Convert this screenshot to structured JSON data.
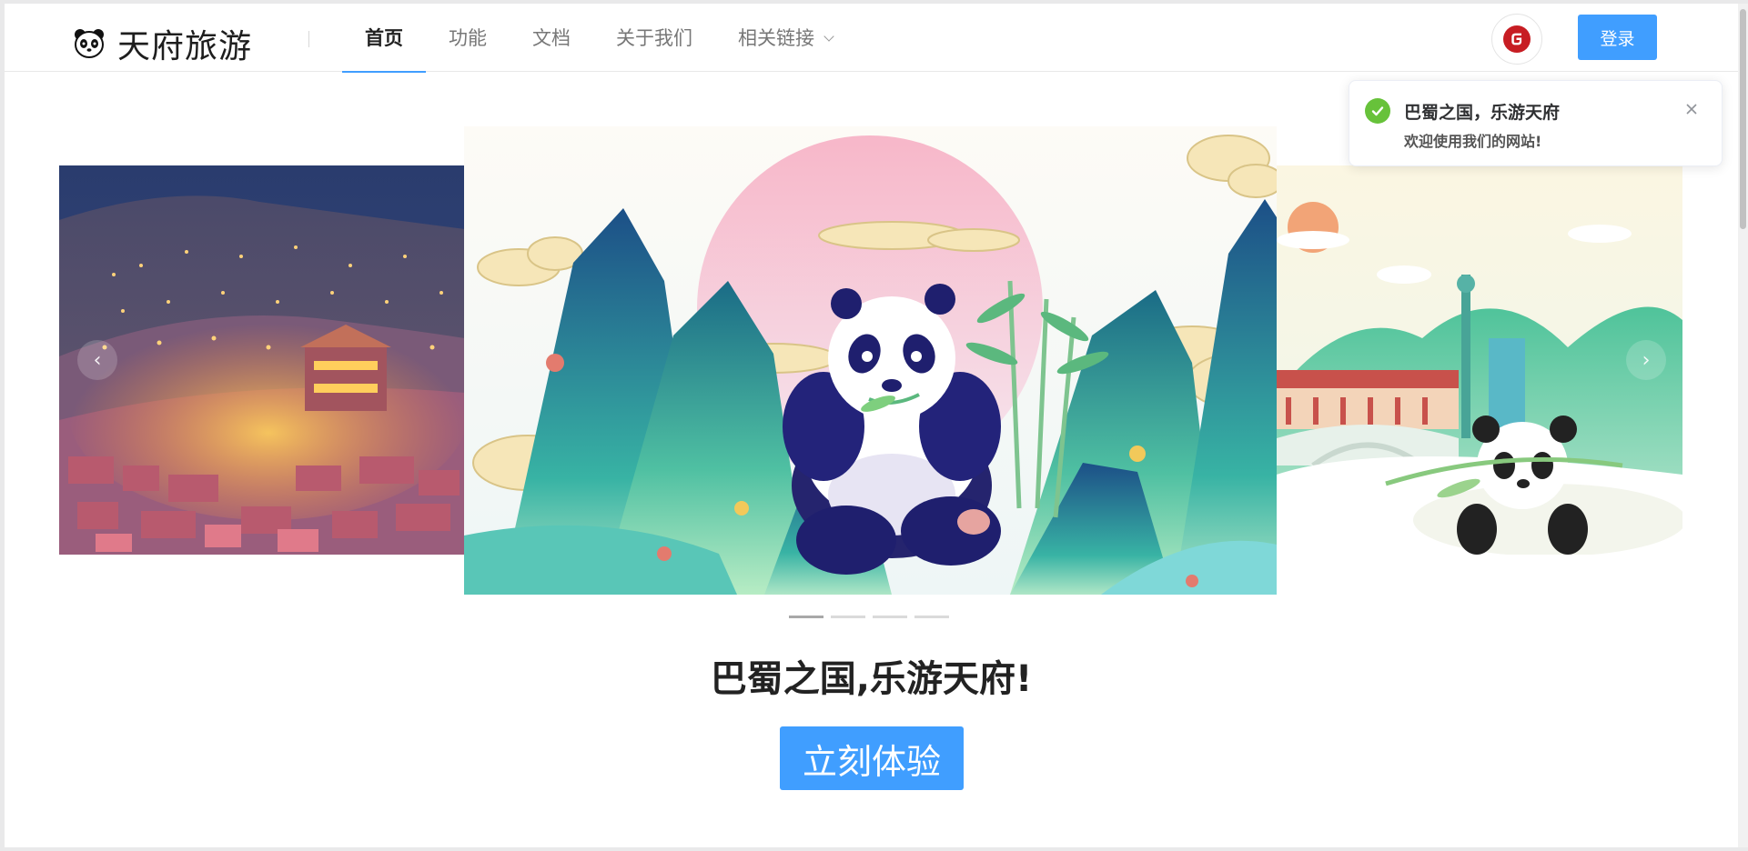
{
  "header": {
    "brand": "天府旅游",
    "nav": [
      {
        "label": "首页",
        "active": true
      },
      {
        "label": "功能",
        "active": false
      },
      {
        "label": "文档",
        "active": false
      },
      {
        "label": "关于我们",
        "active": false
      },
      {
        "label": "相关链接",
        "active": false,
        "dropdown": true
      }
    ],
    "gitee_icon": "gitee-icon",
    "login_label": "登录"
  },
  "carousel": {
    "slides": [
      "night-town-slide",
      "panda-mountains-slide",
      "panda-city-slide"
    ],
    "active_index": 1,
    "indicator_count": 4,
    "prev_icon": "‹",
    "next_icon": "›"
  },
  "main": {
    "slogan": "巴蜀之国,乐游天府!",
    "cta_label": "立刻体验"
  },
  "notification": {
    "type": "success",
    "title": "巴蜀之国，乐游天府",
    "message": "欢迎使用我们的网站!"
  },
  "colors": {
    "primary": "#409eff",
    "success": "#67c23a",
    "gitee": "#c71d23"
  }
}
